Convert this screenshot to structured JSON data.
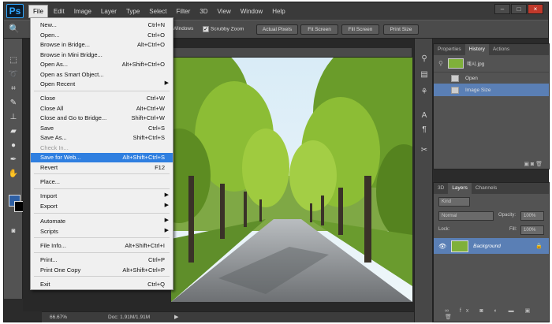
{
  "app": {
    "logo": "Ps"
  },
  "menubar": {
    "items": [
      {
        "label": "File"
      },
      {
        "label": "Edit"
      },
      {
        "label": "Image"
      },
      {
        "label": "Layer"
      },
      {
        "label": "Type"
      },
      {
        "label": "Select"
      },
      {
        "label": "Filter"
      },
      {
        "label": "3D"
      },
      {
        "label": "View"
      },
      {
        "label": "Window"
      },
      {
        "label": "Help"
      }
    ],
    "window_controls": [
      "–",
      "□",
      "×"
    ]
  },
  "options_bar": {
    "windows_label": "Windows",
    "scrubby_zoom": "Scrubby Zoom",
    "actual_pixels": "Actual Pixels",
    "fit_screen": "Fit Screen",
    "fill_screen": "Fill Screen",
    "print_size": "Print Size"
  },
  "file_menu": {
    "new": {
      "label": "New...",
      "shortcut": "Ctrl+N"
    },
    "open": {
      "label": "Open...",
      "shortcut": "Ctrl+O"
    },
    "browse_bridge": {
      "label": "Browse in Bridge...",
      "shortcut": "Alt+Ctrl+O"
    },
    "browse_mini": {
      "label": "Browse in Mini Bridge...",
      "shortcut": ""
    },
    "open_as": {
      "label": "Open As...",
      "shortcut": "Alt+Shift+Ctrl+O"
    },
    "open_smart": {
      "label": "Open as Smart Object...",
      "shortcut": ""
    },
    "open_recent": {
      "label": "Open Recent",
      "shortcut": ""
    },
    "close": {
      "label": "Close",
      "shortcut": "Ctrl+W"
    },
    "close_all": {
      "label": "Close All",
      "shortcut": "Alt+Ctrl+W"
    },
    "close_bridge": {
      "label": "Close and Go to Bridge...",
      "shortcut": "Shift+Ctrl+W"
    },
    "save": {
      "label": "Save",
      "shortcut": "Ctrl+S"
    },
    "save_as": {
      "label": "Save As...",
      "shortcut": "Shift+Ctrl+S"
    },
    "check_in": {
      "label": "Check In...",
      "shortcut": ""
    },
    "save_web": {
      "label": "Save for Web...",
      "shortcut": "Alt+Shift+Ctrl+S"
    },
    "revert": {
      "label": "Revert",
      "shortcut": "F12"
    },
    "place": {
      "label": "Place...",
      "shortcut": ""
    },
    "import": {
      "label": "Import",
      "shortcut": ""
    },
    "export": {
      "label": "Export",
      "shortcut": ""
    },
    "automate": {
      "label": "Automate",
      "shortcut": ""
    },
    "scripts": {
      "label": "Scripts",
      "shortcut": ""
    },
    "file_info": {
      "label": "File Info...",
      "shortcut": "Alt+Shift+Ctrl+I"
    },
    "print": {
      "label": "Print...",
      "shortcut": "Ctrl+P"
    },
    "print_one": {
      "label": "Print One Copy",
      "shortcut": "Alt+Shift+Ctrl+P"
    },
    "exit": {
      "label": "Exit",
      "shortcut": "Ctrl+Q"
    }
  },
  "history_panel": {
    "tabs": [
      "Properties",
      "History",
      "Actions"
    ],
    "snapshot": "예시.jpg",
    "states": [
      "Open",
      "Image Size"
    ]
  },
  "layers_panel": {
    "tabs": [
      "3D",
      "Layers",
      "Channels"
    ],
    "kind_label": "Kind",
    "blend_mode": "Normal",
    "opacity_label": "Opacity:",
    "opacity_value": "100%",
    "lock_label": "Lock:",
    "fill_label": "Fill:",
    "fill_value": "100%",
    "layer_name": "Background"
  },
  "status": {
    "zoom": "66.67%",
    "doc": "Doc: 1.91M/1.91M"
  },
  "colors": {
    "foreground": "#2e5fa3",
    "background": "#000000",
    "selection": "#2f7fe0"
  }
}
